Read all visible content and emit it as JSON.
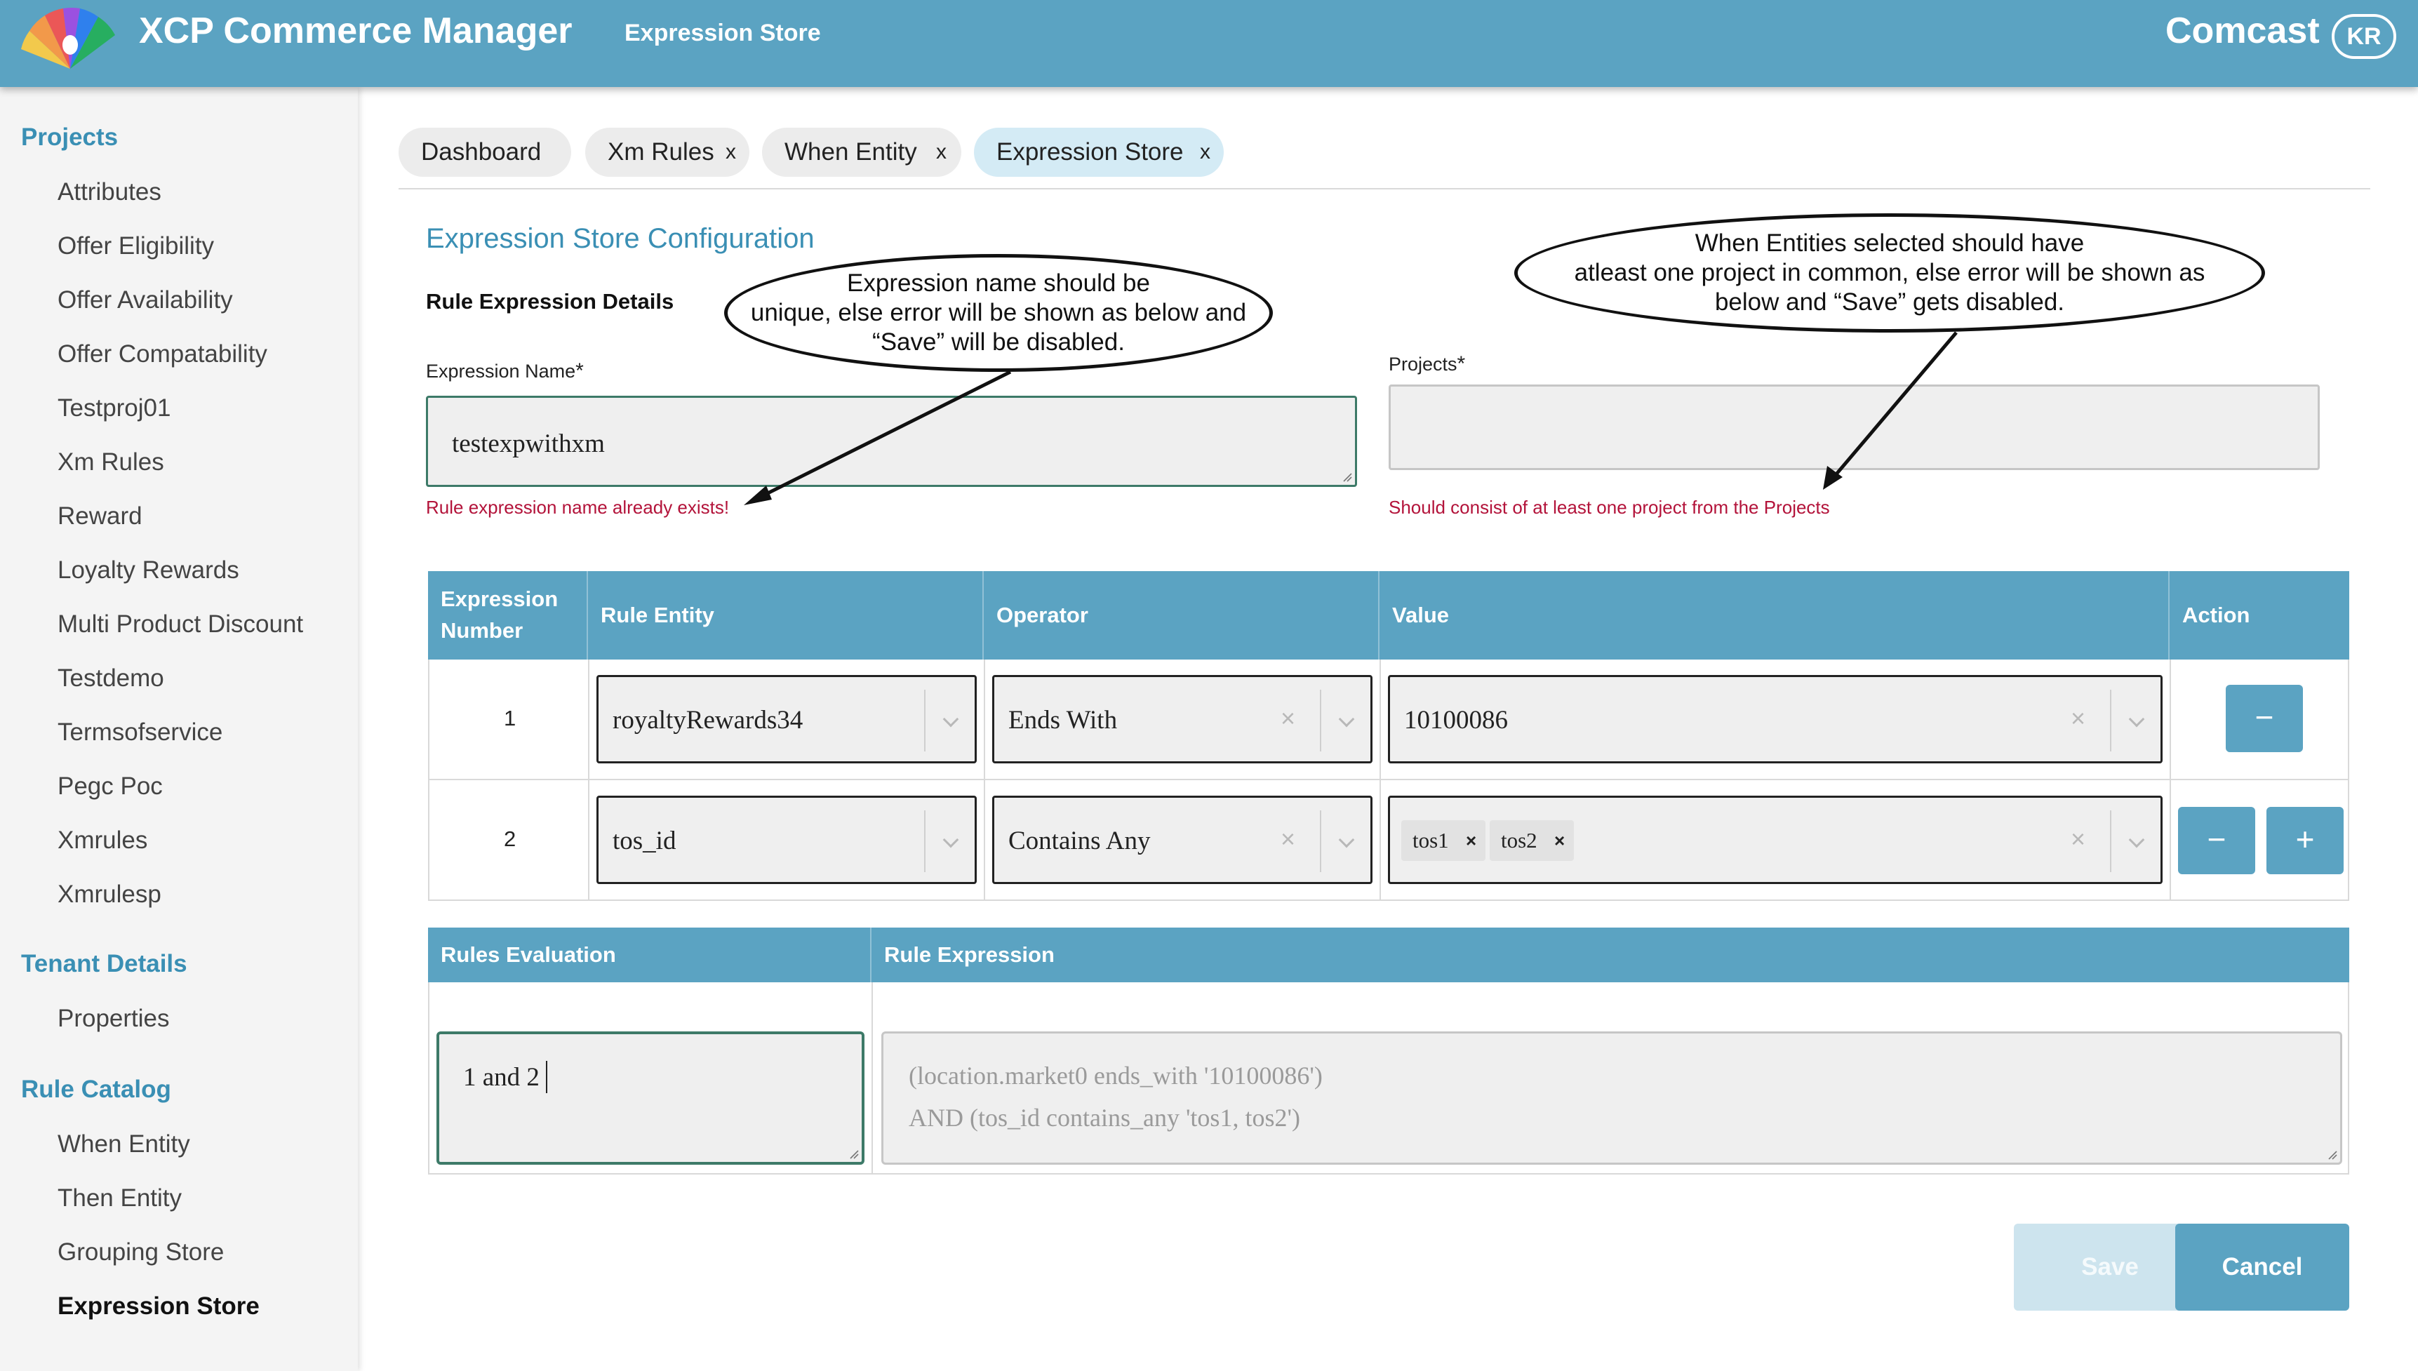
{
  "header": {
    "app_title": "XCP Commerce Manager",
    "section": "Expression Store",
    "brand": "Comcast",
    "user_initials": "KR",
    "colors": {
      "bar": "#5ba3c2",
      "text": "#ffffff"
    }
  },
  "sidebar": {
    "projects_heading": "Projects",
    "projects": [
      "Attributes",
      "Offer Eligibility",
      "Offer Availability",
      "Offer Compatability",
      "Testproj01",
      "Xm Rules",
      "Reward",
      "Loyalty Rewards",
      "Multi Product Discount",
      "Testdemo",
      "Termsofservice",
      "Pegc Poc",
      "Xmrules",
      "Xmrulesp"
    ],
    "tenant_heading": "Tenant Details",
    "tenant_items": [
      "Properties"
    ],
    "catalog_heading": "Rule Catalog",
    "catalog_items": [
      "When Entity",
      "Then Entity",
      "Grouping Store",
      "Expression Store"
    ],
    "active_item": "Expression Store"
  },
  "tabs": [
    {
      "label": "Dashboard",
      "closable": false
    },
    {
      "label": "Xm Rules",
      "closable": true
    },
    {
      "label": "When Entity",
      "closable": true
    },
    {
      "label": "Expression Store",
      "closable": true,
      "active": true
    }
  ],
  "close_glyph": "x",
  "form": {
    "title": "Expression Store Configuration",
    "subheading": "Rule Expression Details",
    "expression_name_label": "Expression Name",
    "required_mark": "*",
    "expression_name_value": "testexpwithxm",
    "expression_name_error": "Rule expression name already exists!",
    "projects_label": "Projects",
    "projects_value": "",
    "projects_error": "Should consist of at least one project from the Projects"
  },
  "callouts": {
    "name_note": [
      "Expression name should be",
      "unique, else error will be shown as below and",
      "“Save” will be disabled."
    ],
    "projects_note": [
      "When Entities selected should have",
      "atleast one project in common, else error will be shown as",
      "below and “Save”  gets disabled."
    ]
  },
  "expr_table": {
    "headers": {
      "number_line1": "Expression",
      "number_line2": "Number",
      "entity": "Rule Entity",
      "operator": "Operator",
      "value": "Value",
      "action": "Action"
    },
    "rows": [
      {
        "number": "1",
        "entity": "royaltyRewards34",
        "operator": "Ends With",
        "value": "10100086",
        "chips": []
      },
      {
        "number": "2",
        "entity": "tos_id",
        "operator": "Contains Any",
        "value": "",
        "chips": [
          "tos1",
          "tos2"
        ]
      }
    ],
    "clear_glyph": "×",
    "chip_remove_glyph": "×",
    "minus_glyph": "−",
    "plus_glyph": "+"
  },
  "eval_table": {
    "headers": {
      "evaluation": "Rules Evaluation",
      "expression": "Rule Expression"
    },
    "evaluation_value": "1 and 2",
    "expression_line1": "(location.market0 ends_with '10100086')",
    "expression_line2": "AND (tos_id contains_any 'tos1, tos2')"
  },
  "actions": {
    "save": "Save",
    "cancel": "Cancel",
    "save_disabled": true
  }
}
